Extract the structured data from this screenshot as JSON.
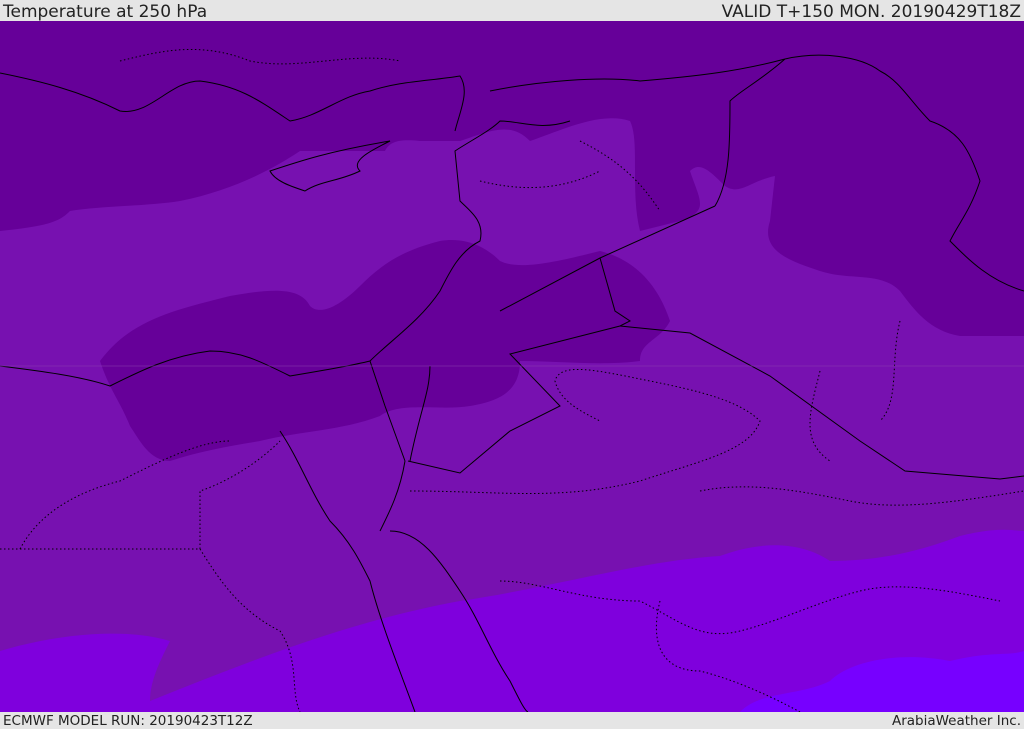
{
  "header": {
    "title": "Temperature at 250 hPa",
    "valid": "VALID T+150 MON. 20190429T18Z"
  },
  "footer": {
    "model_run": "ECMWF MODEL RUN: 20190423T12Z",
    "credit": "ArabiaWeather Inc."
  },
  "colors": {
    "cold_dark": "#660099",
    "mid": "#7711b0",
    "warm": "#7f00dd",
    "warmest": "#7700ff",
    "background": "#e5e5e5"
  }
}
